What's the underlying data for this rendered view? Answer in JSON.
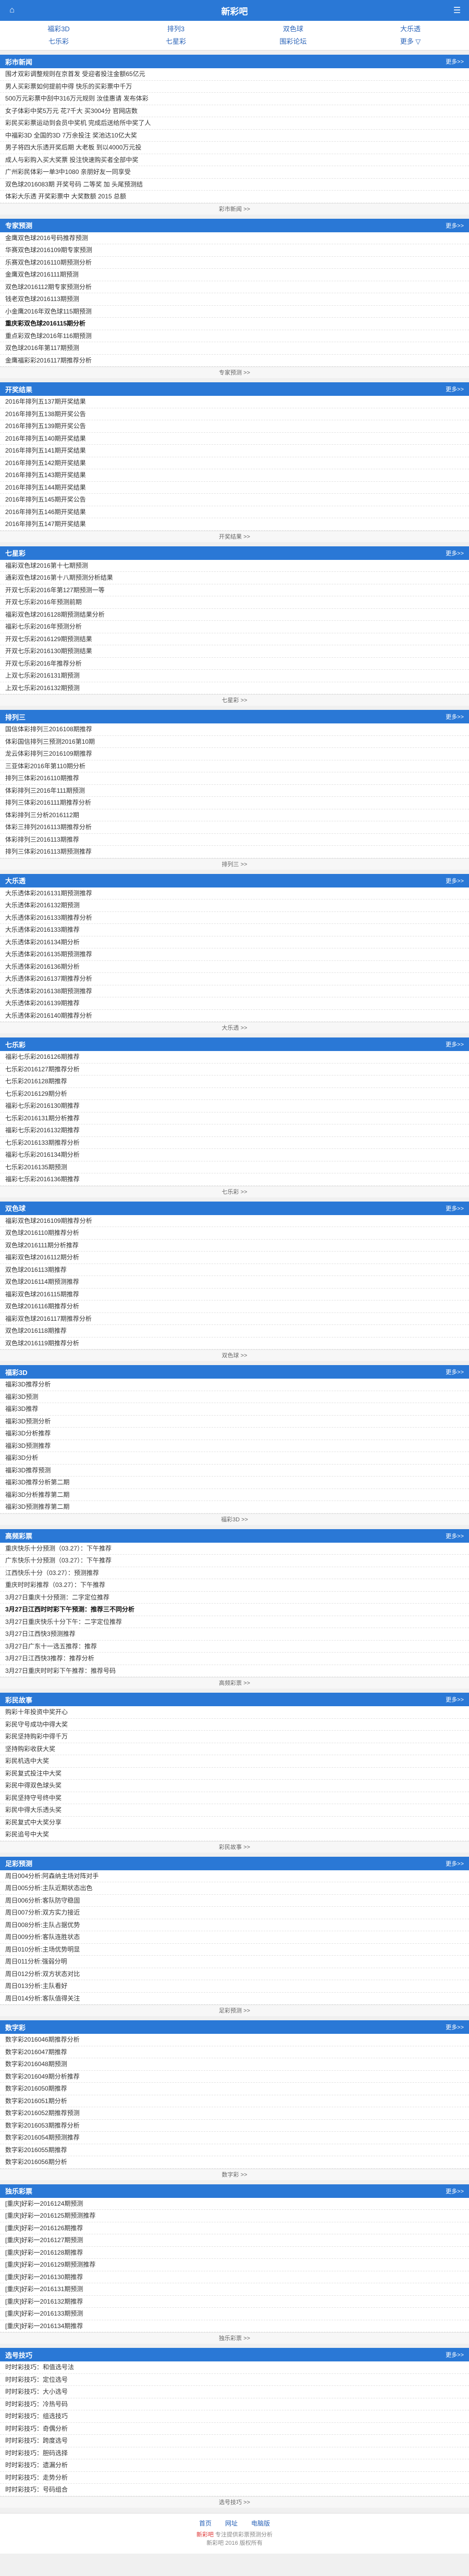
{
  "header": {
    "title": "新彩吧",
    "home_icon": "home-icon",
    "menu_icon": "menu-icon"
  },
  "nav": [
    "福彩3D",
    "排列3",
    "双色球",
    "大乐透",
    "七乐彩",
    "七星彩",
    "围彩论坛",
    "更多 ▽"
  ],
  "more_label": "更多>>",
  "sections": [
    {
      "title": "彩市新闻",
      "foot": "彩市新闻 >>",
      "items": [
        "围才双彩调整规则在京首发 受迎者投注金额65亿元",
        "男人买彩票如何提前中得 快乐的买彩票中千万",
        "500万元彩票中刮中316万元规则 汝佳惠请 发布体彩",
        "女子体彩中奖5万元 花7千大 买3004分 官网店数",
        "彩民买彩票运动到会员中奖机 完成后送给所中奖了人",
        "中福彩3D 全国的3D 7万余投注 奖池达10亿大奖",
        "男子将四大乐透开奖后期 大老板 到以4000万元投",
        "成人与彩购入买大奖票 投注快速购买者全部中奖",
        "广州彩民体彩一单3中1080 亲朋好友一同享受",
        "双色球2016083期 开奖号码 二等奖 加 头尾预测结",
        "体彩大乐透 开奖彩票中 大奖数额 2015 总额"
      ]
    },
    {
      "title": "专家预测",
      "foot": "专家预测 >>",
      "items": [
        "金鹰双色球2016号码推荐预测",
        "华赛双色球2016109期专家预测",
        "乐赛双色球2016110期预测分析",
        "金鹰双色球2016111期预测",
        "双色球2016112期专家预测分析",
        "钱老双色球2016113期预测",
        "小金鹰2016年双色球115期预测",
        "重庆彩双色球2016115期分析",
        "重点彩双色球2016年116期预测",
        "双色球2016年第117期预测",
        "金鹰福彩彩2016117期推荐分析"
      ]
    },
    {
      "title": "开奖结果",
      "foot": "开奖结果 >>",
      "items": [
        "2016年排列五137期开奖结果",
        "2016年排列五138期开奖公告",
        "2016年排列五139期开奖公告",
        "2016年排列五140期开奖结果",
        "2016年排列五141期开奖结果",
        "2016年排列五142期开奖结果",
        "2016年排列五143期开奖结果",
        "2016年排列五144期开奖结果",
        "2016年排列五145期开奖公告",
        "2016年排列五146期开奖结果",
        "2016年排列五147期开奖结果"
      ]
    },
    {
      "title": "七星彩",
      "foot": "七星彩 >>",
      "items": [
        "福彩双色球2016第十七期预测",
        "通彩双色球2016第十八期预测分析结果",
        "开双七乐彩2016年第127期预测一等",
        "开双七乐彩2016年预测前期",
        "福彩双色球2016128期预测结果分析",
        "福彩七乐彩2016年预测分析",
        "开双七乐彩2016129期预测结果",
        "开双七乐彩2016130期预测结果",
        "开双七乐彩2016年推荐分析",
        "上双七乐彩2016131期预测",
        "上双七乐彩2016132期预测"
      ]
    },
    {
      "title": "排列三",
      "foot": "排列三 >>",
      "items": [
        "国信体彩排列三2016108期推荐",
        "体彩国信排列三预测2016第10期",
        "龙云体彩排列三2016109期推荐",
        "三亚体彩2016年第110期分析",
        "排列三体彩2016110期推荐",
        "体彩排列三2016年111期预测",
        "排列三体彩2016111期推荐分析",
        "体彩排列三分析2016112期",
        "体彩三排列2016113期推荐分析",
        "体彩排列三2016113期推荐",
        "排列三体彩2016113期预测推荐"
      ]
    },
    {
      "title": "大乐透",
      "foot": "大乐透 >>",
      "items": [
        "大乐透体彩2016131期预测推荐",
        "大乐透体彩2016132期预测",
        "大乐透体彩2016133期推荐分析",
        "大乐透体彩2016133期推荐",
        "大乐透体彩2016134期分析",
        "大乐透体彩2016135期预测推荐",
        "大乐透体彩2016136期分析",
        "大乐透体彩2016137期推荐分析",
        "大乐透体彩2016138期预测推荐",
        "大乐透体彩2016139期推荐",
        "大乐透体彩2016140期推荐分析"
      ]
    },
    {
      "title": "七乐彩",
      "foot": "七乐彩 >>",
      "items": [
        "福彩七乐彩2016126期推荐",
        "七乐彩2016127期推荐分析",
        "七乐彩2016128期推荐",
        "七乐彩2016129期分析",
        "福彩七乐彩2016130期推荐",
        "七乐彩2016131期分析推荐",
        "福彩七乐彩2016132期推荐",
        "七乐彩2016133期推荐分析",
        "福彩七乐彩2016134期分析",
        "七乐彩2016135期预测",
        "福彩七乐彩2016136期推荐"
      ]
    },
    {
      "title": "双色球",
      "foot": "双色球 >>",
      "items": [
        "福彩双色球2016109期推荐分析",
        "双色球2016110期推荐分析",
        "双色球2016111期分析推荐",
        "福彩双色球2016112期分析",
        "双色球2016113期推荐",
        "双色球2016114期预测推荐",
        "福彩双色球2016115期推荐",
        "双色球2016116期推荐分析",
        "福彩双色球2016117期推荐分析",
        "双色球2016118期推荐",
        "双色球2016119期推荐分析"
      ]
    },
    {
      "title": "福彩3D",
      "foot": "福彩3D >>",
      "items": [
        "福彩3D推荐分析",
        "福彩3D预测",
        "福彩3D推荐",
        "福彩3D预测分析",
        "福彩3D分析推荐",
        "福彩3D预测推荐",
        "福彩3D分析",
        "福彩3D推荐预测",
        "福彩3D推荐分析第二期",
        "福彩3D分析推荐第二期",
        "福彩3D预测推荐第二期"
      ]
    },
    {
      "title": "高频彩票",
      "foot": "高频彩票 >>",
      "items": [
        "重庆快乐十分预测（03.27）：下午推荐",
        "广东快乐十分预测（03.27）：下午推荐",
        "江西快乐十分（03.27）：预测推荐",
        "重庆时时彩推荐（03.27）：下午推荐",
        "3月27日重庆十分预测：二字定位推荐",
        "3月27日江西时时彩下午预测：推荐三不同分析",
        "3月27日重庆快乐十分下午：二字定位推荐",
        "3月27日江西快3预测推荐",
        "3月27日广东十一选五推荐：推荐",
        "3月27日江西快3推荐：推荐分析",
        "3月27日重庆时时彩下午推荐：推荐号码"
      ]
    },
    {
      "title": "彩民故事",
      "foot": "彩民故事 >>",
      "items": [
        "购彩十年投资中奖开心",
        "彩民守号成功中得大奖",
        "彩民坚持购彩中得千万",
        "坚持购彩收获大奖",
        "彩民机选中大奖",
        "彩民复式投注中大奖",
        "彩民中得双色球头奖",
        "彩民坚持守号终中奖",
        "彩民中得大乐透头奖",
        "彩民复式中大奖分享",
        "彩民追号中大奖"
      ]
    },
    {
      "title": "足彩预测",
      "foot": "足彩预测 >>",
      "items": [
        "周日004分析:阿森纳主场对阵对手",
        "周日005分析:主队近期状态出色",
        "周日006分析:客队防守稳固",
        "周日007分析:双方实力接近",
        "周日008分析:主队占据优势",
        "周日009分析:客队连胜状态",
        "周日010分析:主场优势明显",
        "周日011分析:强弱分明",
        "周日012分析:双方状态对比",
        "周日013分析:主队看好",
        "周日014分析:客队值得关注"
      ]
    },
    {
      "title": "数字彩",
      "foot": "数字彩 >>",
      "items": [
        "数字彩2016046期推荐分析",
        "数字彩2016047期推荐",
        "数字彩2016048期预测",
        "数字彩2016049期分析推荐",
        "数字彩2016050期推荐",
        "数字彩2016051期分析",
        "数字彩2016052期推荐预测",
        "数字彩2016053期推荐分析",
        "数字彩2016054期预测推荐",
        "数字彩2016055期推荐",
        "数字彩2016056期分析"
      ]
    },
    {
      "title": "独乐彩票",
      "foot": "独乐彩票 >>",
      "items": [
        "[重庆]好彩一2016124期预测",
        "[重庆]好彩一2016125期预测推荐",
        "[重庆]好彩一2016126期推荐",
        "[重庆]好彩一2016127期预测",
        "[重庆]好彩一2016128期推荐",
        "[重庆]好彩一2016129期预测推荐",
        "[重庆]好彩一2016130期推荐",
        "[重庆]好彩一2016131期预测",
        "[重庆]好彩一2016132期推荐",
        "[重庆]好彩一2016133期预测",
        "[重庆]好彩一2016134期推荐"
      ]
    },
    {
      "title": "选号技巧",
      "foot": "选号技巧 >>",
      "items": [
        "时时彩技巧：和值选号法",
        "时时彩技巧：定位选号",
        "时时彩技巧：大小选号",
        "时时彩技巧：冷热号码",
        "时时彩技巧：组选技巧",
        "时时彩技巧：奇偶分析",
        "时时彩技巧：跨度选号",
        "时时彩技巧：胆码选择",
        "时时彩技巧：遗漏分析",
        "时时彩技巧：走势分析",
        "时时彩技巧：号码组合"
      ]
    }
  ],
  "footer": {
    "links": [
      "首页",
      "网址",
      "电脑版"
    ],
    "brand": "新彩吧",
    "copy1": "专注提供彩票预测分析",
    "copy2": "新彩吧 2016 版权所有",
    "totop": "↑"
  }
}
